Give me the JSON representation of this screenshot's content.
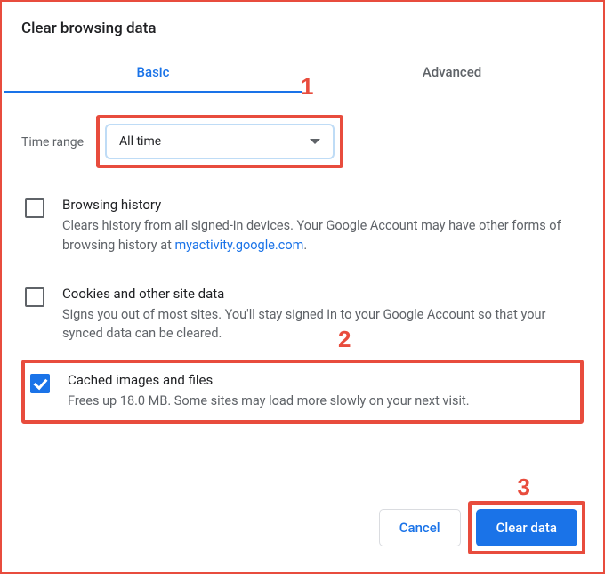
{
  "title": "Clear browsing data",
  "tabs": {
    "basic": "Basic",
    "advanced": "Advanced",
    "active": "basic"
  },
  "time_range": {
    "label": "Time range",
    "value": "All time"
  },
  "options": {
    "history": {
      "checked": false,
      "title": "Browsing history",
      "desc_prefix": "Clears history from all signed-in devices. Your Google Account may have other forms of browsing history at ",
      "link_text": "myactivity.google.com",
      "desc_suffix": "."
    },
    "cookies": {
      "checked": false,
      "title": "Cookies and other site data",
      "desc": "Signs you out of most sites. You'll stay signed in to your Google Account so that your synced data can be cleared."
    },
    "cache": {
      "checked": true,
      "title": "Cached images and files",
      "desc": "Frees up 18.0 MB. Some sites may load more slowly on your next visit."
    }
  },
  "buttons": {
    "cancel": "Cancel",
    "clear": "Clear data"
  },
  "annotations": {
    "a1": "1",
    "a2": "2",
    "a3": "3"
  }
}
